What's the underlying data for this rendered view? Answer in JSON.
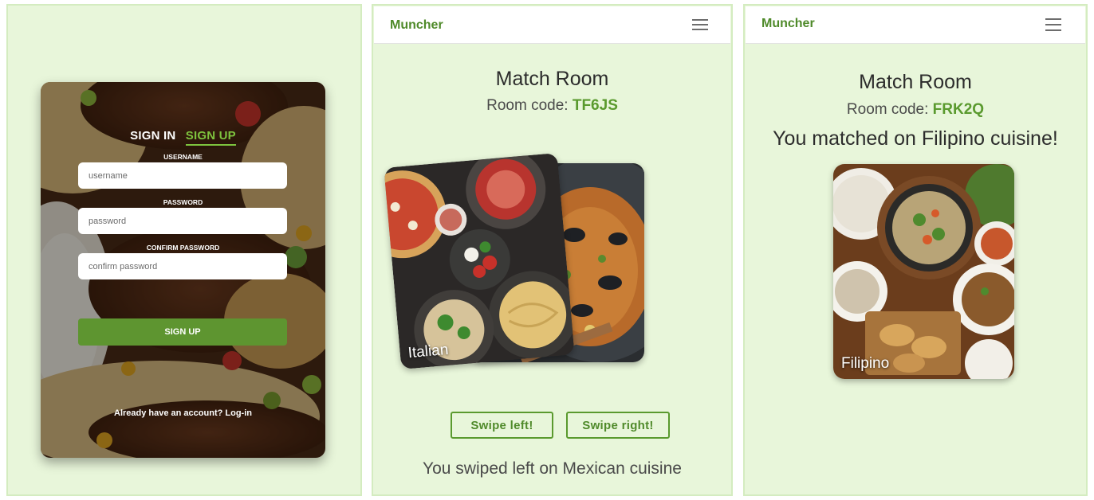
{
  "auth": {
    "tab_signin": "SIGN IN",
    "tab_signup": "SIGN UP",
    "username_label": "USERNAME",
    "username_placeholder": "username",
    "password_label": "PASSWORD",
    "password_placeholder": "password",
    "confirm_label": "CONFIRM PASSWORD",
    "confirm_placeholder": "confirm password",
    "submit_label": "SIGN UP",
    "login_link": "Already have an account? Log-in"
  },
  "room1": {
    "brand": "Muncher",
    "title": "Match Room",
    "code_prefix": "Room code: ",
    "code": "TF6JS",
    "front_card_label": "Italian",
    "swipe_left_label": "Swipe left!",
    "swipe_right_label": "Swipe right!",
    "status": "You swiped left on Mexican cuisine"
  },
  "room2": {
    "brand": "Muncher",
    "title": "Match Room",
    "code_prefix": "Room code: ",
    "code": "FRK2Q",
    "match_message": "You matched on Filipino cuisine!",
    "card_label": "Filipino"
  },
  "colors": {
    "panel_bg": "#e8f6da",
    "accent": "#5a9a2e",
    "brand": "#4f8a2a",
    "signup_tab": "#7ec33e"
  },
  "icons": [
    "hamburger-menu-icon"
  ]
}
